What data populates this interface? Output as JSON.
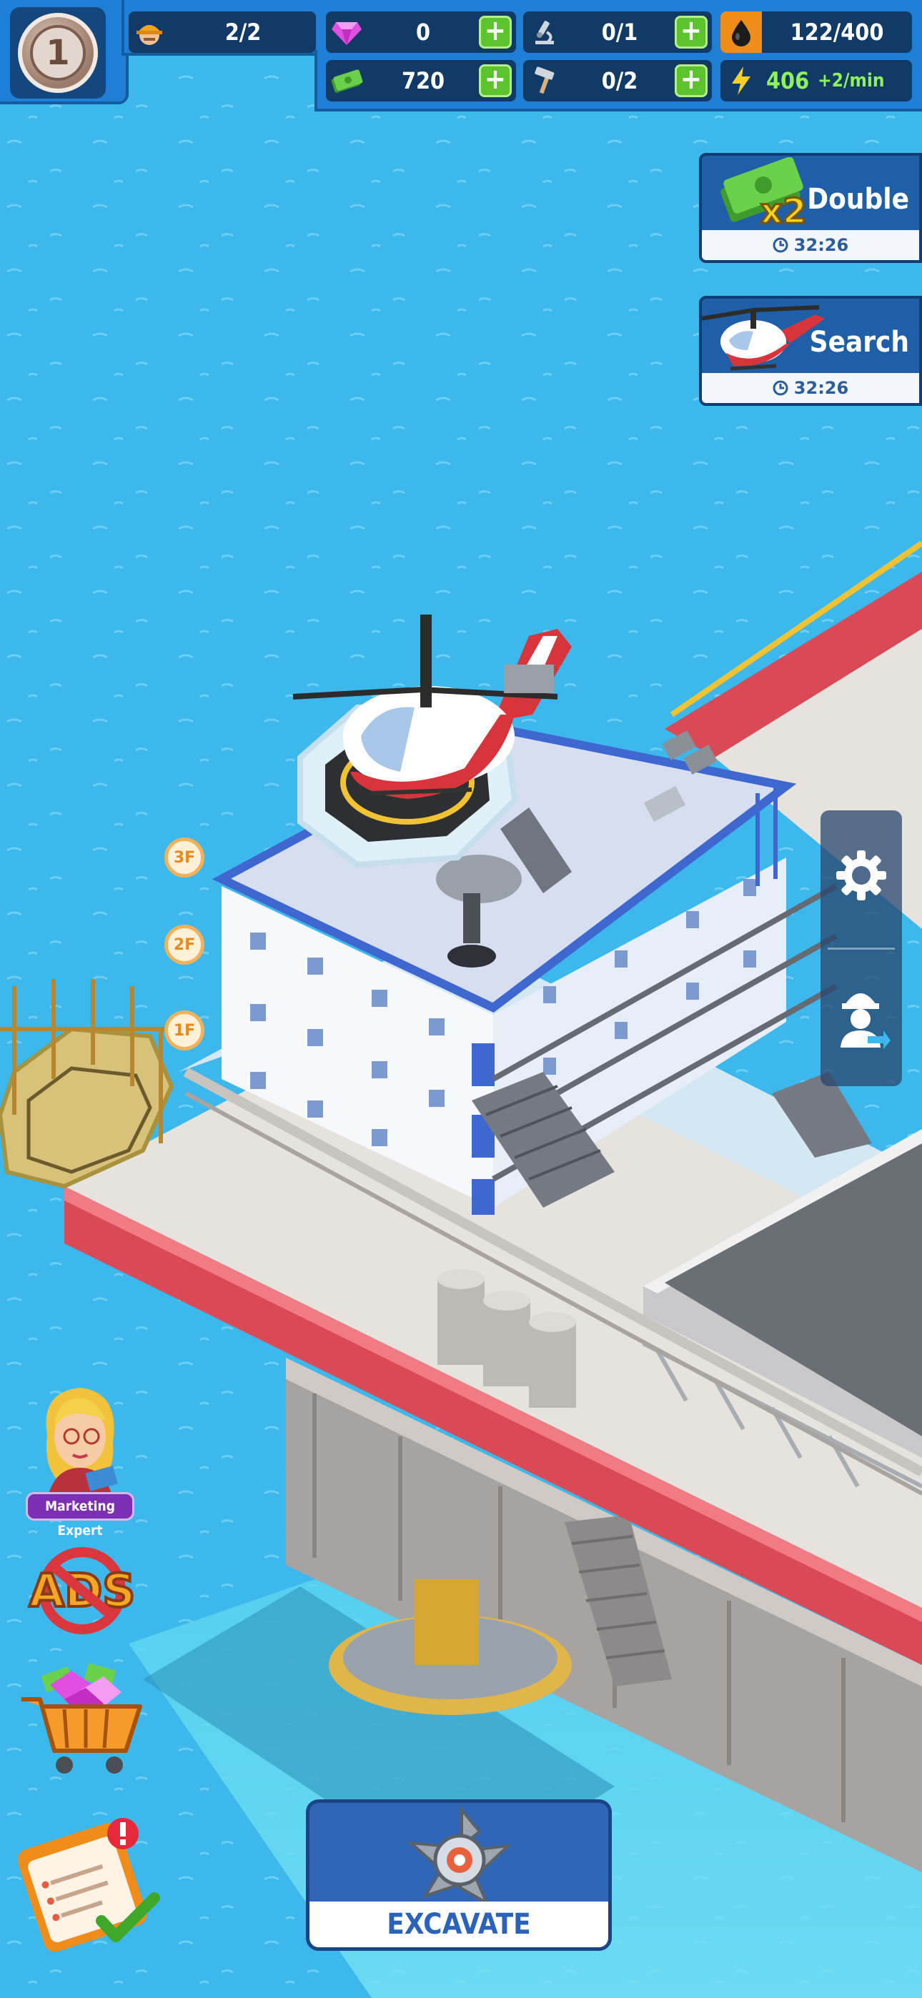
{
  "level": "1",
  "resources": {
    "workers": "2/2",
    "gems": "0",
    "researchers": "0/1",
    "oil": "122/400",
    "cash": "720",
    "tools": "0/2",
    "energy": "406",
    "energy_rate": "+2/min"
  },
  "boosts": [
    {
      "label": "Double",
      "timer": "32:26",
      "icon": "cash-x2-icon"
    },
    {
      "label": "Search",
      "timer": "32:26",
      "icon": "helicopter-icon"
    }
  ],
  "floors": [
    "3F",
    "2F",
    "1F"
  ],
  "side_tools": [
    "gear-icon",
    "worker-exit-icon"
  ],
  "left_buttons": {
    "marketing_label": "Marketing Expert",
    "ads_label": "ADS"
  },
  "excavate_label": "EXCAVATE",
  "colors": {
    "sea": "#3db8ec",
    "hud_blue": "#1f7fd6",
    "plus_green": "#5cc22e",
    "platform_red": "#d94a56",
    "railing_yellow": "#f1c232"
  }
}
